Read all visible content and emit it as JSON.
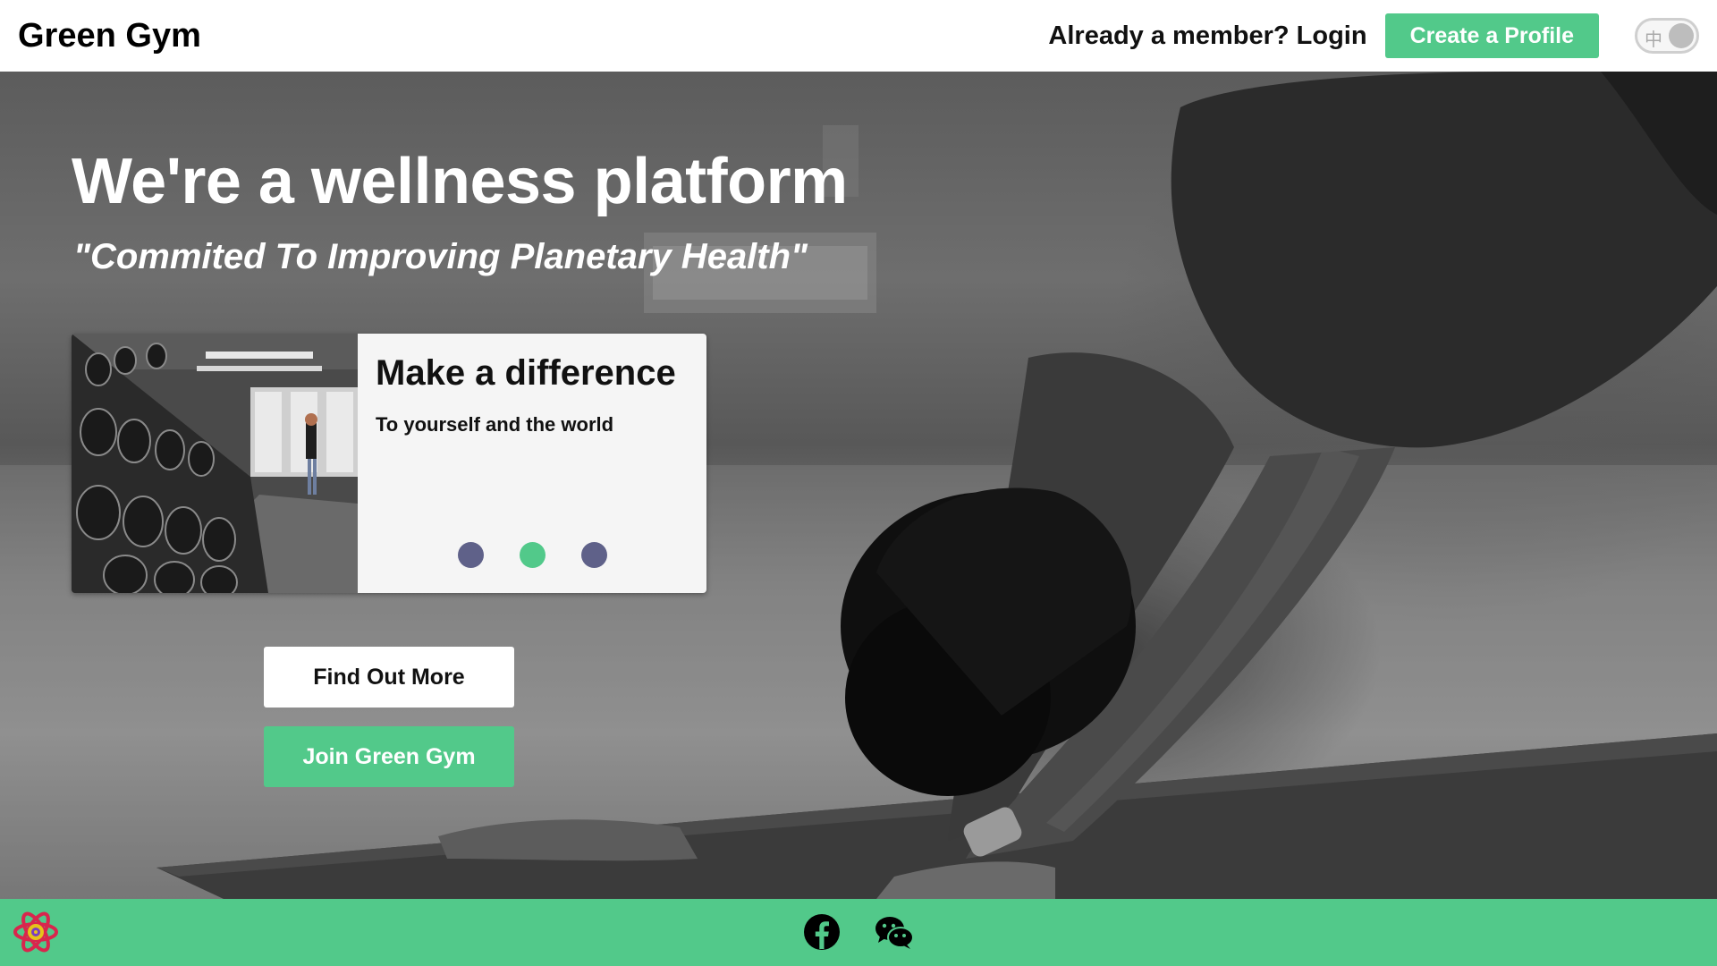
{
  "header": {
    "brand": "Green Gym",
    "login_link": "Already a member? Login",
    "create_profile": "Create a Profile",
    "language_toggle_char": "中"
  },
  "hero": {
    "title": "We're a wellness platform",
    "subtitle": "\"Commited To Improving Planetary Health\""
  },
  "card": {
    "title": "Make a difference",
    "text": "To yourself and the world",
    "carousel_slide_count": 3,
    "active_slide_index": 1
  },
  "buttons": {
    "find_out_more": "Find Out More",
    "join": "Join Green Gym"
  },
  "footer": {
    "icons": [
      "react-logo-icon",
      "facebook-icon",
      "wechat-icon"
    ]
  },
  "colors": {
    "accent_green": "#52c98a",
    "dot_inactive": "#5f6189"
  }
}
